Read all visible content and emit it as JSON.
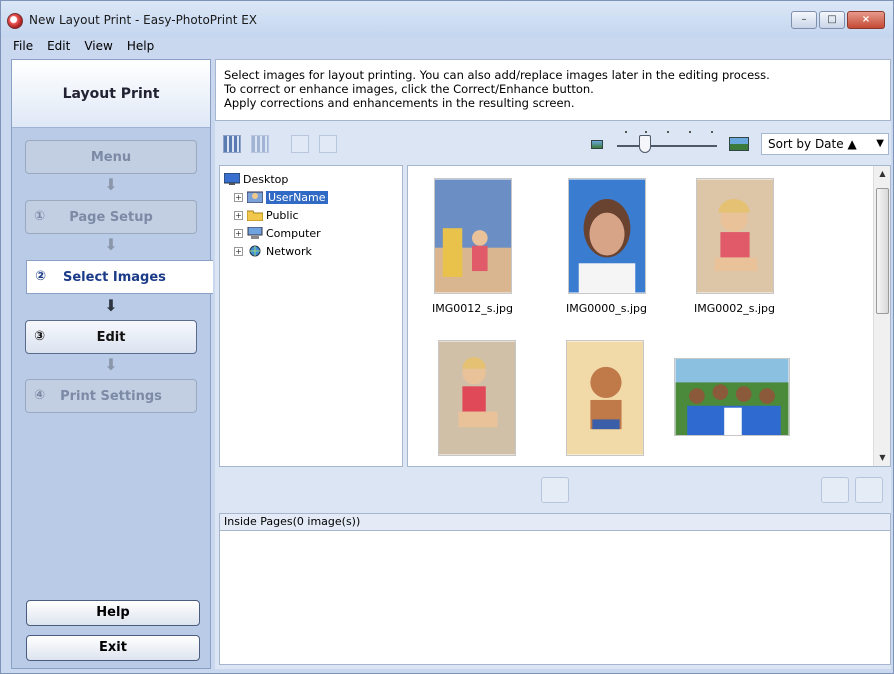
{
  "window": {
    "title": "New Layout Print - Easy-PhotoPrint EX",
    "controls": [
      "–",
      "□",
      "×"
    ]
  },
  "menu": [
    {
      "label": "File"
    },
    {
      "label": "Edit"
    },
    {
      "label": "View"
    },
    {
      "label": "Help"
    }
  ],
  "sidebar": {
    "title": "Layout Print",
    "menu_label": "Menu",
    "steps": [
      {
        "num": "①",
        "label": "Page Setup"
      },
      {
        "num": "②",
        "label": "Select Images"
      },
      {
        "num": "③",
        "label": "Edit"
      },
      {
        "num": "④",
        "label": "Print Settings"
      }
    ],
    "help_label": "Help",
    "exit_label": "Exit"
  },
  "instructions": [
    "Select images for layout printing. You can also add/replace images later in the editing process.",
    "To correct or enhance images, click the Correct/Enhance button.",
    "Apply corrections and enhancements in the resulting screen."
  ],
  "toolbar": {
    "sort_label": "Sort by Date",
    "sort_direction": "▲"
  },
  "tree": {
    "root": "Desktop",
    "items": [
      "UserName",
      "Public",
      "Computer",
      "Network"
    ],
    "selected": "UserName"
  },
  "thumbnails": [
    {
      "caption": "IMG0012_s.jpg",
      "colors": [
        "#e8c24a",
        "#d9b690",
        "#6b8ec4"
      ]
    },
    {
      "caption": "IMG0000_s.jpg",
      "colors": [
        "#3a7cd0",
        "#d8a487",
        "#f5f5f5"
      ]
    },
    {
      "caption": "IMG0002_s.jpg",
      "colors": [
        "#c9b49a",
        "#e05a6a",
        "#ddc6a8"
      ]
    },
    {
      "caption": "",
      "colors": [
        "#d1c0a8",
        "#e04a58",
        "#c8b294"
      ]
    },
    {
      "caption": "",
      "colors": [
        "#f2d9a8",
        "#c07a4a",
        "#3a5fa8"
      ]
    },
    {
      "caption": "",
      "colors": [
        "#4a8a3a",
        "#c07a4a",
        "#ffffff"
      ]
    }
  ],
  "pages_panel": {
    "header": "Inside Pages(0 image(s))"
  }
}
